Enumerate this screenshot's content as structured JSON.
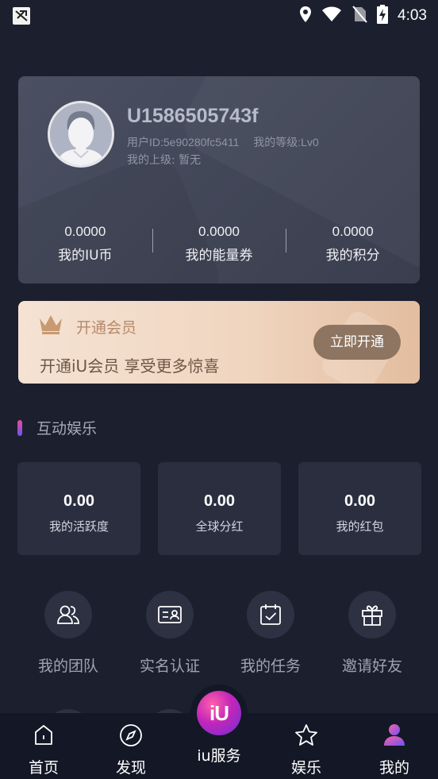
{
  "status_bar": {
    "time": "4:03"
  },
  "profile": {
    "username": "U1586505743f",
    "user_id": "用户ID:5e90280fc5411",
    "level": "我的等级:Lv0",
    "superior": "我的上级: 暂无",
    "stats": [
      {
        "value": "0.0000",
        "label": "我的IU币"
      },
      {
        "value": "0.0000",
        "label": "我的能量券"
      },
      {
        "value": "0.0000",
        "label": "我的积分"
      }
    ]
  },
  "vip": {
    "title": "开通会员",
    "subtitle": "开通iU会员 享受更多惊喜",
    "button": "立即开通"
  },
  "section": {
    "title": "互动娱乐"
  },
  "cards": [
    {
      "value": "0.00",
      "label": "我的活跃度"
    },
    {
      "value": "0.00",
      "label": "全球分红"
    },
    {
      "value": "0.00",
      "label": "我的红包"
    }
  ],
  "shortcuts": [
    {
      "label": "我的团队",
      "icon": "team-icon"
    },
    {
      "label": "实名认证",
      "icon": "id-card-icon"
    },
    {
      "label": "我的任务",
      "icon": "task-calendar-icon"
    },
    {
      "label": "邀请好友",
      "icon": "gift-icon"
    }
  ],
  "tabs": [
    {
      "label": "首页",
      "icon": "home-icon"
    },
    {
      "label": "发现",
      "icon": "compass-icon"
    },
    {
      "label": "iu服务",
      "icon": "iu-logo-icon",
      "logo_text": "iU"
    },
    {
      "label": "娱乐",
      "icon": "star-icon"
    },
    {
      "label": "我的",
      "icon": "user-icon",
      "active": true
    }
  ],
  "colors": {
    "background": "#1c1f2e",
    "card": "#2a2e3f",
    "accent_pink": "#e84a9a",
    "accent_purple": "#6a55f0",
    "vip_gold": "#b58a6a"
  }
}
